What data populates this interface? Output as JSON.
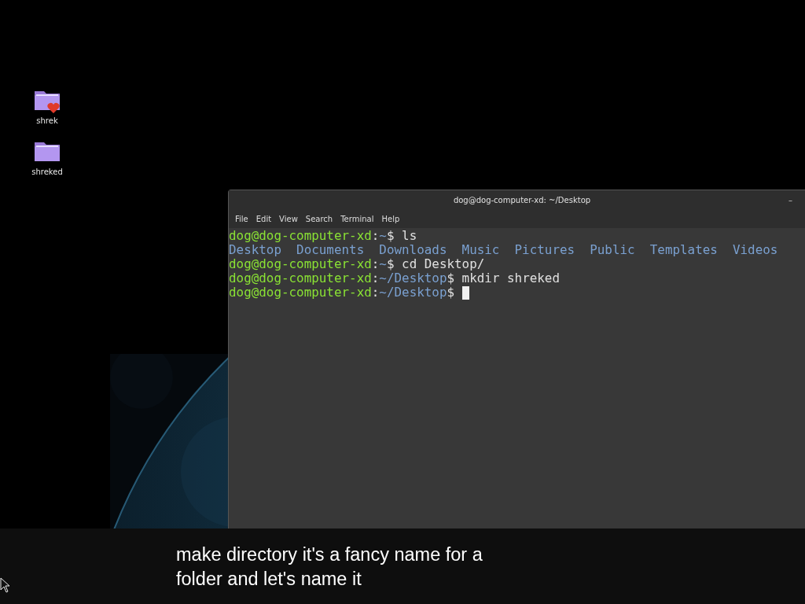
{
  "desktop_icons": [
    {
      "label": "shrek",
      "emblem": true
    },
    {
      "label": "shreked",
      "emblem": false
    }
  ],
  "terminal": {
    "title": "dog@dog-computer-xd: ~/Desktop",
    "minimize": "–",
    "menu": [
      "File",
      "Edit",
      "View",
      "Search",
      "Terminal",
      "Help"
    ],
    "lines": [
      {
        "kind": "prompt",
        "user": "dog@dog-computer-xd",
        "colon": ":",
        "path": "~",
        "dollar": "$ ",
        "command": "ls",
        "cursor": false
      },
      {
        "kind": "listing",
        "text": "Desktop  Documents  Downloads  Music  Pictures  Public  Templates  Videos"
      },
      {
        "kind": "prompt",
        "user": "dog@dog-computer-xd",
        "colon": ":",
        "path": "~",
        "dollar": "$ ",
        "command": "cd Desktop/",
        "cursor": false
      },
      {
        "kind": "prompt",
        "user": "dog@dog-computer-xd",
        "colon": ":",
        "path": "~/Desktop",
        "dollar": "$ ",
        "command": "mkdir shreked",
        "cursor": false
      },
      {
        "kind": "prompt",
        "user": "dog@dog-computer-xd",
        "colon": ":",
        "path": "~/Desktop",
        "dollar": "$ ",
        "cursor": true
      }
    ]
  },
  "caption": {
    "lines": [
      "make directory it's a fancy name for a",
      "folder and let's name it"
    ]
  }
}
